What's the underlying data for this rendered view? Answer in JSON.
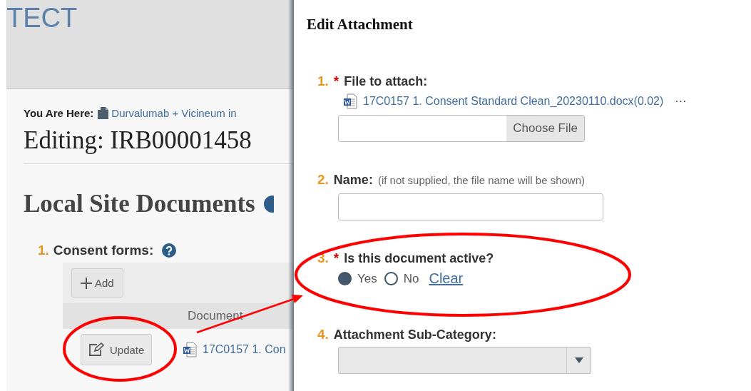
{
  "header": {
    "logo_text": "TECT"
  },
  "breadcrumb": {
    "label": "You Are Here:",
    "item": "Durvalumab + Vicineum in"
  },
  "page_title": "Editing: IRB00001458",
  "section": {
    "title": "Local Site Documents",
    "questions": [
      {
        "number": "1.",
        "label": "Consent forms:",
        "add_button": "Add",
        "columns": [
          "Document"
        ],
        "rows": [
          {
            "action": "Update",
            "document": "17C0157 1. Con"
          }
        ]
      }
    ]
  },
  "dialog": {
    "title": "Edit Attachment",
    "fields": [
      {
        "kind": "file",
        "number": "1.",
        "required_mark": "*",
        "label": "File to attach:",
        "file_link": "17C0157 1. Consent Standard Clean_20230110.docx(0.02)",
        "more": "···",
        "button": "Choose File"
      },
      {
        "kind": "text",
        "number": "2.",
        "label": "Name:",
        "hint": "(if not supplied, the file name will be shown)"
      },
      {
        "kind": "radio",
        "number": "3.",
        "required_mark": "*",
        "label": "Is this document active?",
        "options": [
          {
            "label": "Yes",
            "selected": true
          },
          {
            "label": "No",
            "selected": false
          }
        ],
        "clear": "Clear"
      },
      {
        "kind": "select",
        "number": "4.",
        "label": "Attachment Sub-Category:"
      }
    ]
  }
}
